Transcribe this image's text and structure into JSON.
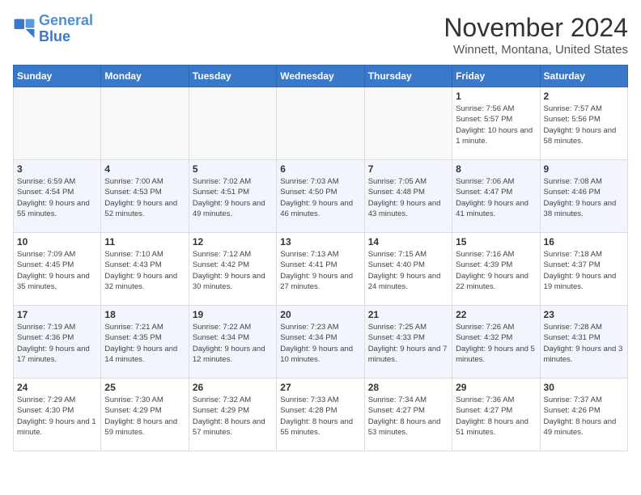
{
  "logo": {
    "line1": "General",
    "line2": "Blue"
  },
  "title": "November 2024",
  "location": "Winnett, Montana, United States",
  "days_header": [
    "Sunday",
    "Monday",
    "Tuesday",
    "Wednesday",
    "Thursday",
    "Friday",
    "Saturday"
  ],
  "weeks": [
    [
      {
        "day": "",
        "info": ""
      },
      {
        "day": "",
        "info": ""
      },
      {
        "day": "",
        "info": ""
      },
      {
        "day": "",
        "info": ""
      },
      {
        "day": "",
        "info": ""
      },
      {
        "day": "1",
        "info": "Sunrise: 7:56 AM\nSunset: 5:57 PM\nDaylight: 10 hours and 1 minute."
      },
      {
        "day": "2",
        "info": "Sunrise: 7:57 AM\nSunset: 5:56 PM\nDaylight: 9 hours and 58 minutes."
      }
    ],
    [
      {
        "day": "3",
        "info": "Sunrise: 6:59 AM\nSunset: 4:54 PM\nDaylight: 9 hours and 55 minutes."
      },
      {
        "day": "4",
        "info": "Sunrise: 7:00 AM\nSunset: 4:53 PM\nDaylight: 9 hours and 52 minutes."
      },
      {
        "day": "5",
        "info": "Sunrise: 7:02 AM\nSunset: 4:51 PM\nDaylight: 9 hours and 49 minutes."
      },
      {
        "day": "6",
        "info": "Sunrise: 7:03 AM\nSunset: 4:50 PM\nDaylight: 9 hours and 46 minutes."
      },
      {
        "day": "7",
        "info": "Sunrise: 7:05 AM\nSunset: 4:48 PM\nDaylight: 9 hours and 43 minutes."
      },
      {
        "day": "8",
        "info": "Sunrise: 7:06 AM\nSunset: 4:47 PM\nDaylight: 9 hours and 41 minutes."
      },
      {
        "day": "9",
        "info": "Sunrise: 7:08 AM\nSunset: 4:46 PM\nDaylight: 9 hours and 38 minutes."
      }
    ],
    [
      {
        "day": "10",
        "info": "Sunrise: 7:09 AM\nSunset: 4:45 PM\nDaylight: 9 hours and 35 minutes."
      },
      {
        "day": "11",
        "info": "Sunrise: 7:10 AM\nSunset: 4:43 PM\nDaylight: 9 hours and 32 minutes."
      },
      {
        "day": "12",
        "info": "Sunrise: 7:12 AM\nSunset: 4:42 PM\nDaylight: 9 hours and 30 minutes."
      },
      {
        "day": "13",
        "info": "Sunrise: 7:13 AM\nSunset: 4:41 PM\nDaylight: 9 hours and 27 minutes."
      },
      {
        "day": "14",
        "info": "Sunrise: 7:15 AM\nSunset: 4:40 PM\nDaylight: 9 hours and 24 minutes."
      },
      {
        "day": "15",
        "info": "Sunrise: 7:16 AM\nSunset: 4:39 PM\nDaylight: 9 hours and 22 minutes."
      },
      {
        "day": "16",
        "info": "Sunrise: 7:18 AM\nSunset: 4:37 PM\nDaylight: 9 hours and 19 minutes."
      }
    ],
    [
      {
        "day": "17",
        "info": "Sunrise: 7:19 AM\nSunset: 4:36 PM\nDaylight: 9 hours and 17 minutes."
      },
      {
        "day": "18",
        "info": "Sunrise: 7:21 AM\nSunset: 4:35 PM\nDaylight: 9 hours and 14 minutes."
      },
      {
        "day": "19",
        "info": "Sunrise: 7:22 AM\nSunset: 4:34 PM\nDaylight: 9 hours and 12 minutes."
      },
      {
        "day": "20",
        "info": "Sunrise: 7:23 AM\nSunset: 4:34 PM\nDaylight: 9 hours and 10 minutes."
      },
      {
        "day": "21",
        "info": "Sunrise: 7:25 AM\nSunset: 4:33 PM\nDaylight: 9 hours and 7 minutes."
      },
      {
        "day": "22",
        "info": "Sunrise: 7:26 AM\nSunset: 4:32 PM\nDaylight: 9 hours and 5 minutes."
      },
      {
        "day": "23",
        "info": "Sunrise: 7:28 AM\nSunset: 4:31 PM\nDaylight: 9 hours and 3 minutes."
      }
    ],
    [
      {
        "day": "24",
        "info": "Sunrise: 7:29 AM\nSunset: 4:30 PM\nDaylight: 9 hours and 1 minute."
      },
      {
        "day": "25",
        "info": "Sunrise: 7:30 AM\nSunset: 4:29 PM\nDaylight: 8 hours and 59 minutes."
      },
      {
        "day": "26",
        "info": "Sunrise: 7:32 AM\nSunset: 4:29 PM\nDaylight: 8 hours and 57 minutes."
      },
      {
        "day": "27",
        "info": "Sunrise: 7:33 AM\nSunset: 4:28 PM\nDaylight: 8 hours and 55 minutes."
      },
      {
        "day": "28",
        "info": "Sunrise: 7:34 AM\nSunset: 4:27 PM\nDaylight: 8 hours and 53 minutes."
      },
      {
        "day": "29",
        "info": "Sunrise: 7:36 AM\nSunset: 4:27 PM\nDaylight: 8 hours and 51 minutes."
      },
      {
        "day": "30",
        "info": "Sunrise: 7:37 AM\nSunset: 4:26 PM\nDaylight: 8 hours and 49 minutes."
      }
    ]
  ]
}
